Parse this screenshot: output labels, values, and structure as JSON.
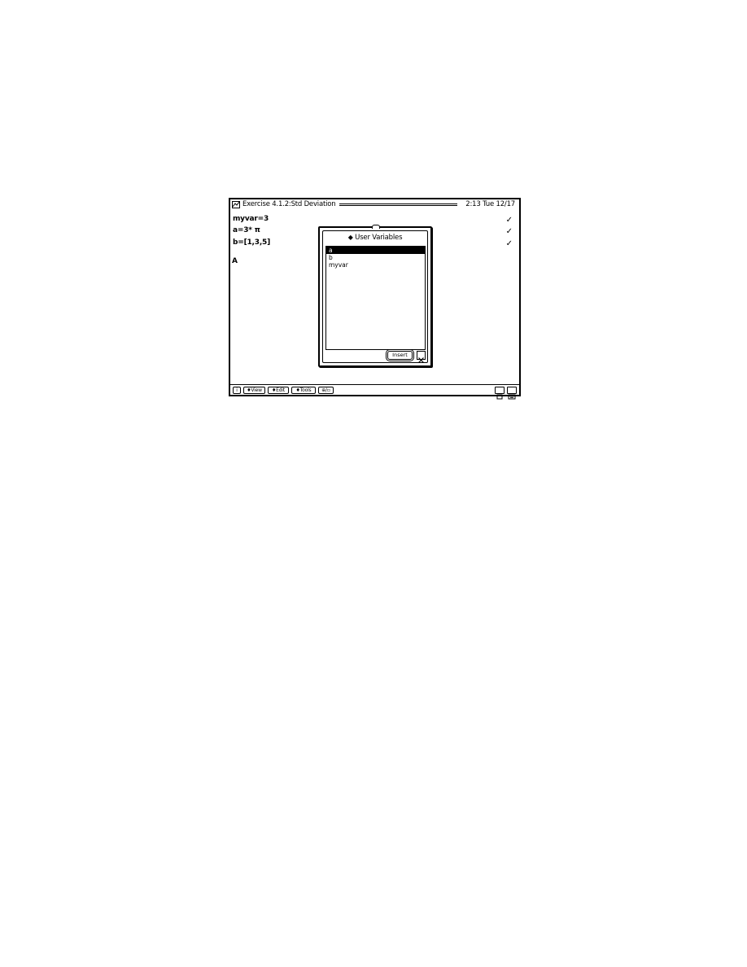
{
  "titlebar": {
    "title": "Exercise 4.1.2:Std Deviation",
    "clock": "2:13 Tue 12/17"
  },
  "entries": [
    {
      "expr": "myvar=3",
      "result": "✓"
    },
    {
      "expr": "a=3* π",
      "result": "✓"
    },
    {
      "expr": "b=[1,3,5]",
      "result": "✓"
    }
  ],
  "cursor_prompt": "A",
  "dialog": {
    "title": "User Variables",
    "variables": [
      "a",
      "b",
      "myvar"
    ],
    "selected_index": 0,
    "insert_label": "Insert"
  },
  "bottombar": {
    "info_label": "i",
    "menus": [
      "♦View",
      "♦Edit",
      "♦Tools"
    ],
    "mode_label": "⊕/▫"
  }
}
